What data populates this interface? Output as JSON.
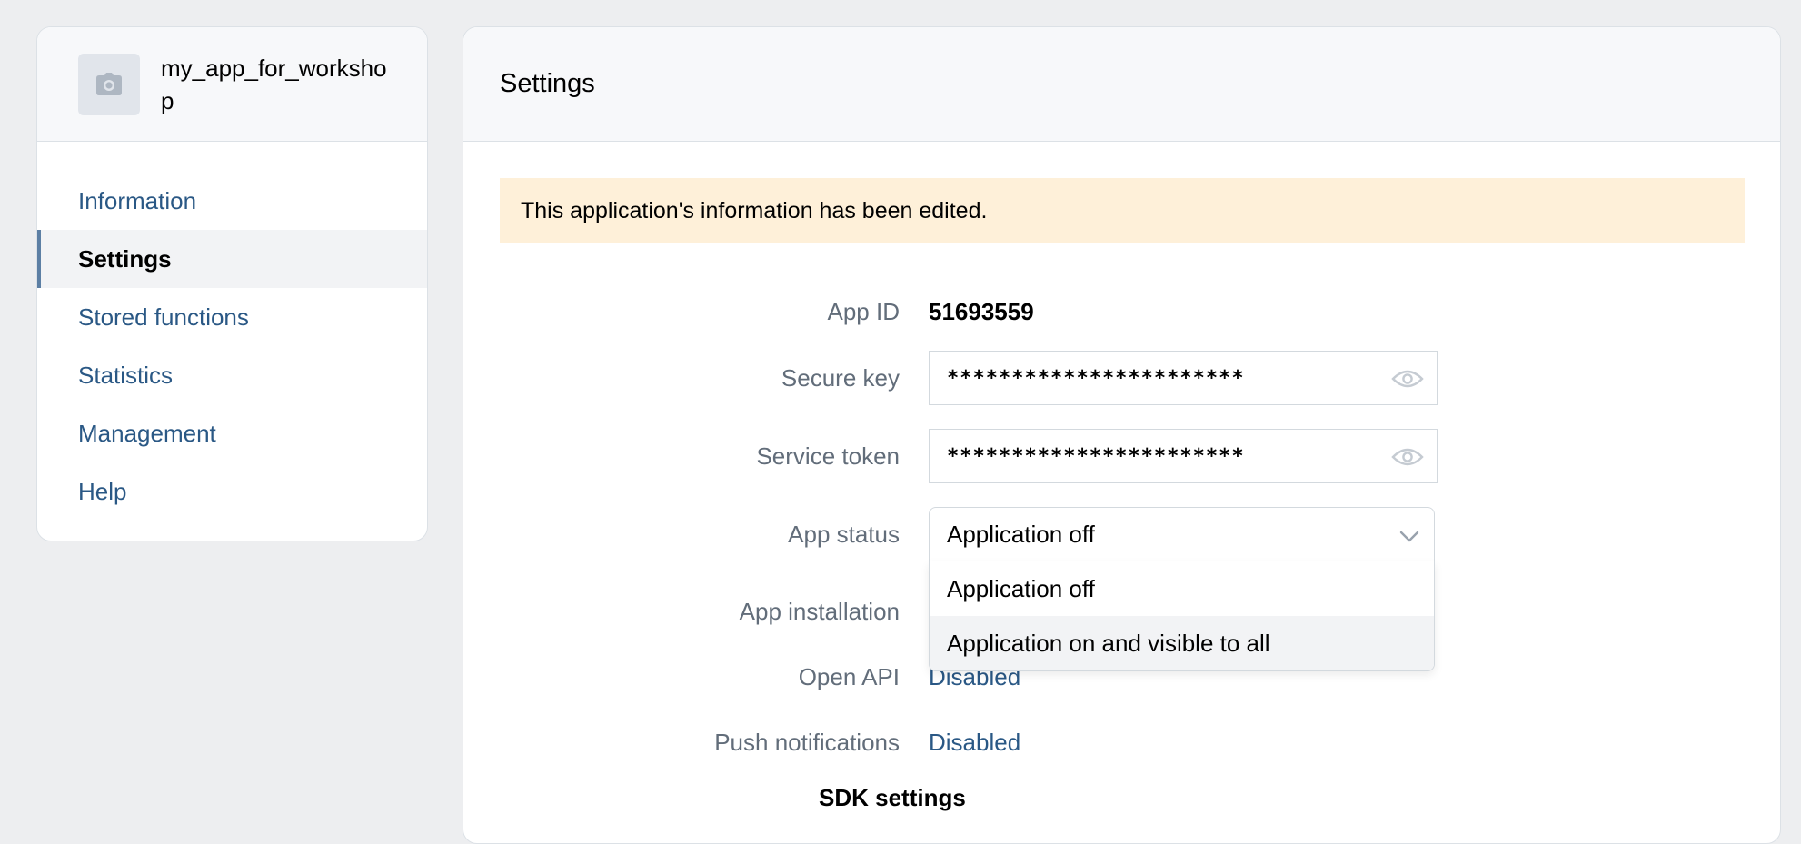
{
  "sidebar": {
    "app_name": "my_app_for_workshop",
    "items": [
      {
        "label": "Information"
      },
      {
        "label": "Settings"
      },
      {
        "label": "Stored functions"
      },
      {
        "label": "Statistics"
      },
      {
        "label": "Management"
      },
      {
        "label": "Help"
      }
    ],
    "active_item": "Settings"
  },
  "main": {
    "title": "Settings",
    "notice": "This application's information has been edited.",
    "fields": {
      "app_id": {
        "label": "App ID",
        "value": "51693559"
      },
      "secure_key": {
        "label": "Secure key",
        "value": "***********************"
      },
      "service_token": {
        "label": "Service token",
        "value": "***********************"
      },
      "app_status": {
        "label": "App status",
        "value": "Application off"
      },
      "app_installation": {
        "label": "App installation"
      },
      "open_api": {
        "label": "Open API",
        "value": "Disabled"
      },
      "push_notifications": {
        "label": "Push notifications",
        "value": "Disabled"
      }
    },
    "status_dropdown": {
      "options": [
        "Application off",
        "Application on and visible to all"
      ],
      "hovered": "Application on and visible to all"
    },
    "section_title": "SDK settings"
  },
  "icons": {
    "avatar": "camera-icon",
    "reveal": "eye-icon",
    "select": "chevron-down-icon"
  },
  "colors": {
    "link": "#2a5885",
    "notice_bg": "#fef0d9",
    "label": "#626d7a",
    "active_marker": "#5c7fa4"
  }
}
